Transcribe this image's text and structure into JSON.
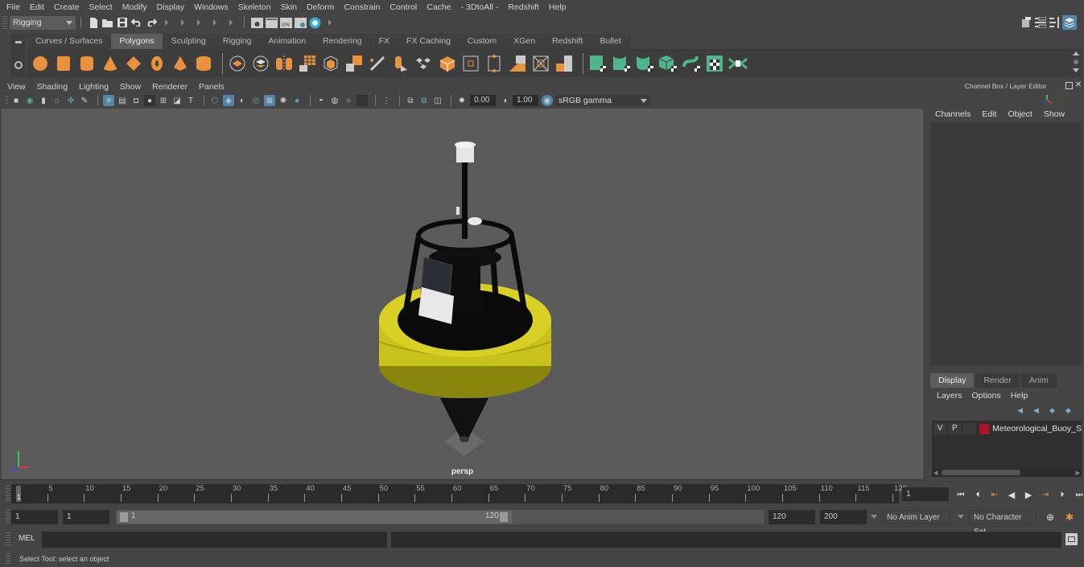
{
  "menubar": {
    "items": [
      "File",
      "Edit",
      "Create",
      "Select",
      "Modify",
      "Display",
      "Windows",
      "Skeleton",
      "Skin",
      "Deform",
      "Constrain",
      "Control",
      "Cache",
      "- 3DtoAll -",
      "Redshift",
      "Help"
    ]
  },
  "statusline": {
    "menuset": "Rigging",
    "icons": [
      "new-scene-icon",
      "open-scene-icon",
      "save-scene-icon",
      "undo-icon",
      "redo-icon"
    ],
    "render_icons": [
      "render-view-icon",
      "render-frame-icon",
      "ipr-render-icon",
      "render-settings-icon",
      "hypershade-icon"
    ],
    "ipr_label": "IPR"
  },
  "shelf": {
    "tabs": [
      "Curves / Surfaces",
      "Polygons",
      "Sculpting",
      "Rigging",
      "Animation",
      "Rendering",
      "FX",
      "FX Caching",
      "Custom",
      "XGen",
      "Redshift",
      "Bullet"
    ],
    "active_tab": "Polygons",
    "orange_icons": [
      "poly-sphere-icon",
      "poly-cube-icon",
      "poly-cylinder-icon",
      "poly-cone-icon",
      "poly-plane-icon",
      "poly-torus-icon",
      "poly-pyramid-icon",
      "poly-pipe-icon"
    ],
    "tool_icons": [
      "combine-icon",
      "separate-icon",
      "mirror-icon",
      "smooth-icon",
      "extrude-icon",
      "bridge-icon",
      "multicut-icon",
      "insert-edgeloop-icon",
      "bevel-icon",
      "merge-icon",
      "target-weld-icon",
      "append-polygon-icon",
      "fill-hole-icon",
      "triangulate-icon",
      "quadrangulate-icon",
      "reduce-icon",
      "cleanup-icon"
    ],
    "uv_icons": [
      "planar-uv-icon",
      "cylindrical-uv-icon",
      "spherical-uv-icon",
      "automatic-uv-icon",
      "unfold-uv-icon",
      "uv-editor-icon",
      "uv-cut-sew-icon"
    ]
  },
  "viewport": {
    "menu": [
      "View",
      "Shading",
      "Lighting",
      "Show",
      "Renderer",
      "Panels"
    ],
    "exposure": "0.00",
    "gamma": "1.00",
    "colorspace": "sRGB gamma",
    "camera_label": "persp"
  },
  "channel_box": {
    "title": "Channel Box / Layer Editor",
    "menu": [
      "Channels",
      "Edit",
      "Object",
      "Show"
    ]
  },
  "layer_editor": {
    "tabs": [
      "Display",
      "Render",
      "Anim"
    ],
    "active_tab": "Display",
    "menu": [
      "Layers",
      "Options",
      "Help"
    ],
    "layers": [
      {
        "visible": "V",
        "playback": "P",
        "color": "#b0102a",
        "name": "Meteorological_Buoy_Sy"
      }
    ]
  },
  "timeline": {
    "ticks": [
      5,
      10,
      15,
      20,
      25,
      30,
      35,
      40,
      45,
      50,
      55,
      60,
      65,
      70,
      75,
      80,
      85,
      90,
      95,
      100,
      105,
      110,
      115,
      120
    ],
    "start": 1,
    "end": 120,
    "current_frame": "1",
    "current_marker": "1"
  },
  "range": {
    "anim_start": "1",
    "playback_start": "1",
    "slider_start_label": "1",
    "slider_end_label": "120",
    "playback_end": "120",
    "anim_end": "200",
    "anim_layer": "No Anim Layer",
    "character_set": "No Character Set"
  },
  "command_line": {
    "label": "MEL",
    "input": "",
    "output": ""
  },
  "help_line": {
    "text": "Select Tool: select an object"
  },
  "colors": {
    "accent_blue": "#5285a6",
    "shelf_orange": "#e8923e",
    "shelf_green": "#4eb58c",
    "buoy_yellow": "#c9c21a",
    "layer_color": "#b0102a"
  }
}
